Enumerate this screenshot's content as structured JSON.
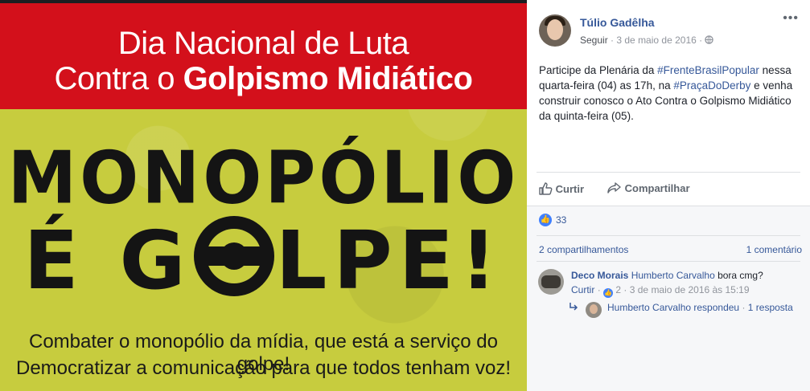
{
  "image": {
    "banner_line1": "Dia Nacional de Luta",
    "banner_line2_normal": "Contra o",
    "banner_line2_bold": "Golpismo Midiático",
    "headline_line1": "MONOPÓLIO",
    "headline_line2_start": "É G",
    "headline_line2_end": "LPE!",
    "footer_line1": "Combater o monopólio da mídia, que está a serviço do golpe!",
    "footer_line2": "Democratizar a comunicação para que todos tenham voz!"
  },
  "post": {
    "author": "Túlio Gadêlha",
    "follow": "Seguir",
    "date": "3 de maio de 2016",
    "separator": "·",
    "globe_icon": "globe-icon",
    "more_icon": "ellipsis-icon",
    "text_1": "Participe da Plenária da ",
    "hashtag_1": "#FrenteBrasilPopular",
    "text_2": " nessa quarta-feira (04) as 17h, na ",
    "hashtag_2": "#PraçaDoDerby",
    "text_3": " e venha construir conosco o Ato Contra o Golpismo Midiático da quinta-feira (05)."
  },
  "actions": {
    "like_label": "Curtir",
    "share_label": "Compartilhar",
    "like_icon": "thumbs-up-icon",
    "share_icon": "share-arrow-icon"
  },
  "stats": {
    "likes": "33",
    "shares": "2 compartilhamentos",
    "comments": "1 comentário"
  },
  "comment": {
    "author": "Deco Morais",
    "tagged": "Humberto Carvalho",
    "text": " bora cmg?",
    "like_label": "Curtir",
    "like_count": "2",
    "date": "3 de maio de 2016 às 15:19",
    "reply_text": "Humberto Carvalho respondeu",
    "reply_count": "1 resposta",
    "reply_icon": "reply-arrow-icon"
  },
  "colors": {
    "link": "#365899",
    "banner_red": "#d3101b",
    "poster_yellow": "#c7cc3e",
    "like_blue": "#4080ff"
  }
}
